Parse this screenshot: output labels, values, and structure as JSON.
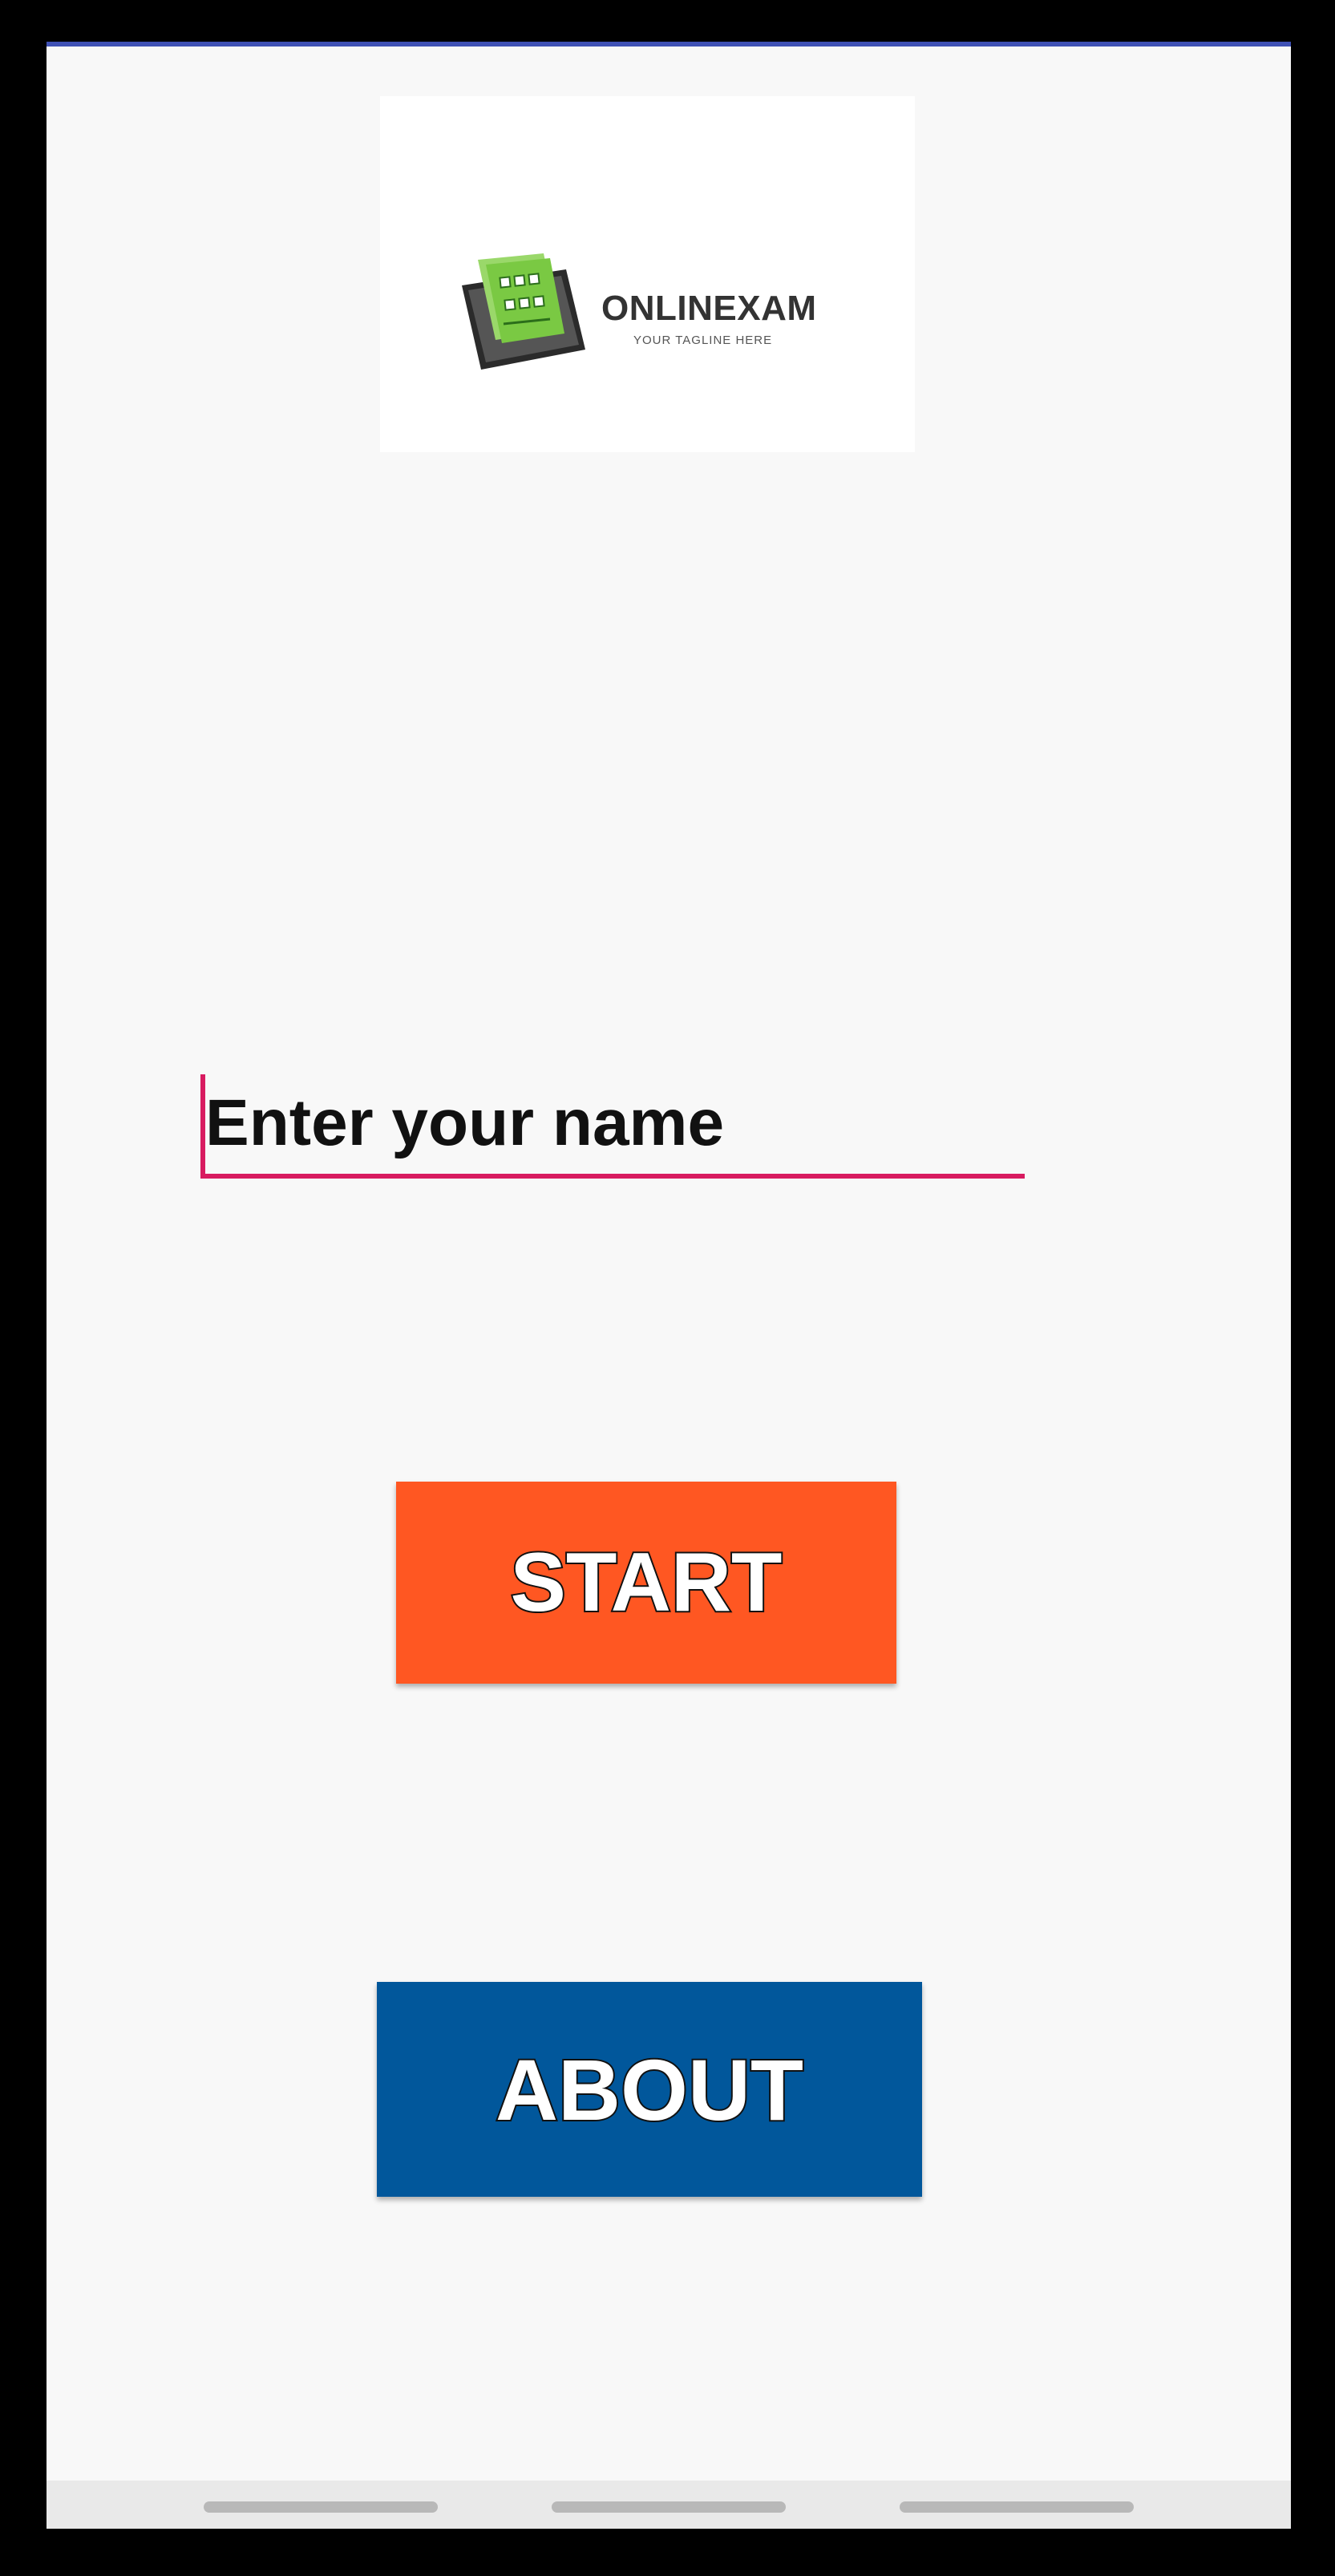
{
  "logo": {
    "title": "ONLINEXAM",
    "tagline": "YOUR TAGLINE HERE",
    "icon": "tablet-checklist-icon"
  },
  "name_input": {
    "placeholder": "Enter your name",
    "value": ""
  },
  "buttons": {
    "start_label": "START",
    "about_label": "ABOUT"
  },
  "nav": {
    "items": [
      "recents",
      "home",
      "back"
    ]
  },
  "colors": {
    "accent": "#d81b60",
    "start": "#ff5722",
    "about": "#01579b",
    "top_bar": "#3f51b5",
    "logo_green": "#7ac943"
  }
}
